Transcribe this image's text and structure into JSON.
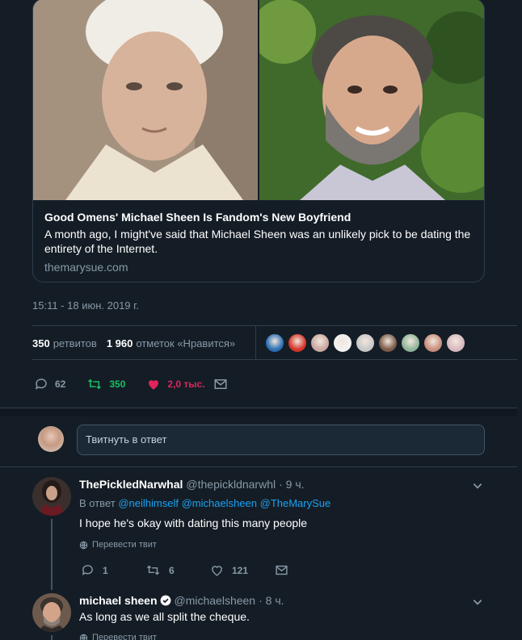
{
  "card": {
    "title": "Good Omens' Michael Sheen Is Fandom's New Boyfriend",
    "description": "A month ago, I might've said that Michael Sheen was an unlikely pick to be dating the entirety of the Internet.",
    "domain": "themarysue.com"
  },
  "tweet": {
    "timestamp": "15:11 - 18 июн. 2019 г.",
    "retweets_count": "350",
    "retweets_label": "ретвитов",
    "likes_count": "1 960",
    "likes_label": "отметок «Нравится»",
    "liker_avatar_colors": [
      "#2b6fb3",
      "#d6342a",
      "#c9a9a1",
      "#f2f2f2",
      "#c8c8c8",
      "#7b5b4a",
      "#8fb59a",
      "#c98f7d",
      "#d8b9c0"
    ],
    "actions": {
      "reply_count": "62",
      "retweet_count": "350",
      "like_count": "2,0 тыс."
    }
  },
  "reply_box": {
    "placeholder": "Твитнуть в ответ"
  },
  "replies": [
    {
      "name": "ThePickledNarwhal",
      "handle": "@thepickldnarwhl",
      "time": "· 9 ч.",
      "reply_prefix": "В ответ",
      "mentions": [
        "@neilhimself",
        "@michaelsheen",
        "@TheMarySue"
      ],
      "text": "I hope he's okay with dating this many people",
      "translate": "Перевести твит",
      "reply_count": "1",
      "retweet_count": "6",
      "like_count": "121"
    },
    {
      "name": "michael sheen",
      "handle": "@michaelsheen",
      "time": "· 8 ч.",
      "text": "As long as we all split the cheque.",
      "translate": "Перевести твит"
    }
  ],
  "colors": {
    "background": "#141d26",
    "accent": "#1da1f2",
    "retweet_green": "#17bf63",
    "like_red": "#e0245e",
    "muted": "#8899a6"
  }
}
